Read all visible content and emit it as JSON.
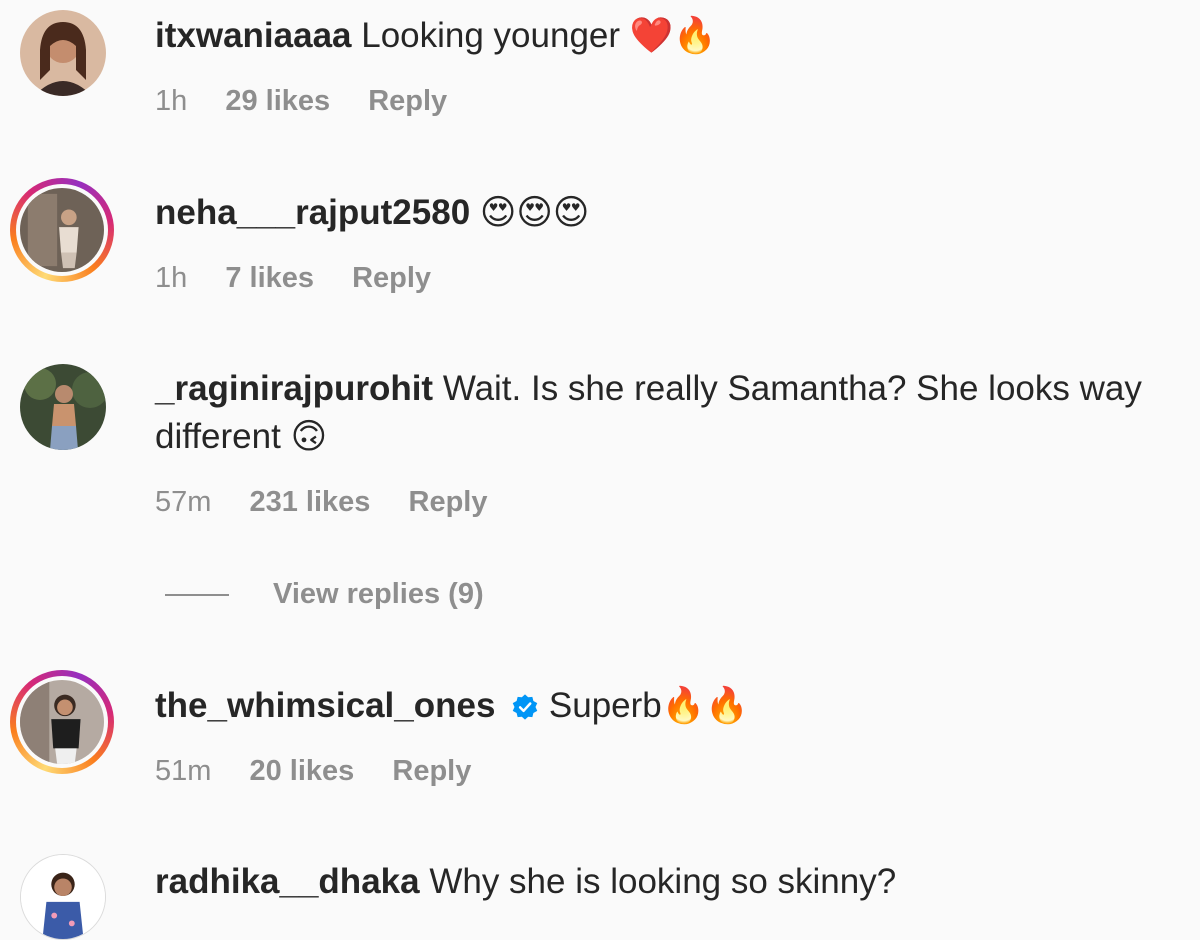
{
  "comments": [
    {
      "username": "itxwaniaaaa",
      "text": "Looking younger",
      "emoji": "❤️🔥",
      "time": "1h",
      "likes": "29 likes",
      "reply": "Reply"
    },
    {
      "username": "neha___rajput2580",
      "text": "",
      "emoji": "😍😍😍",
      "time": "1h",
      "likes": "7 likes",
      "reply": "Reply"
    },
    {
      "username": "_raginirajpurohit",
      "text": "Wait. Is she really Samantha? She looks way different",
      "emoji": "🙃",
      "time": "57m",
      "likes": "231 likes",
      "reply": "Reply",
      "view_replies": "View replies (9)"
    },
    {
      "username": "the_whimsical_ones",
      "text": "Superb",
      "emoji": "🔥🔥",
      "time": "51m",
      "likes": "20 likes",
      "reply": "Reply"
    },
    {
      "username": "radhika__dhaka",
      "text": "Why she is looking so skinny?",
      "emoji": "",
      "time": "",
      "likes": "",
      "reply": ""
    }
  ],
  "colors": {
    "background": "#fafafa",
    "text": "#262626",
    "secondary": "#8e8e8e",
    "verified": "#0095f6"
  }
}
